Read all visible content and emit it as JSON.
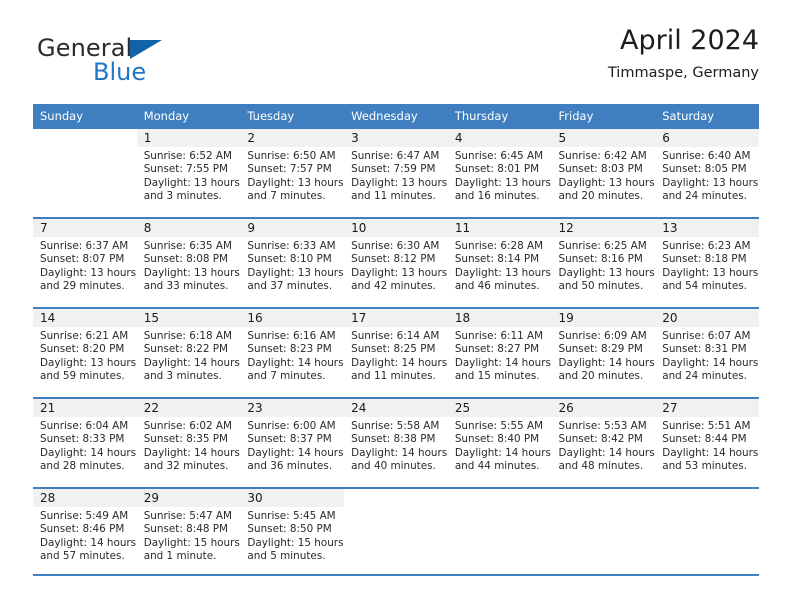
{
  "brand": {
    "name_part1": "General",
    "name_part2": "Blue",
    "flag_icon": "triangle-flag-icon",
    "accent_color": "#1f77c4",
    "header_color": "#3f7fbf"
  },
  "header": {
    "title": "April 2024",
    "subtitle": "Timmaspe, Germany"
  },
  "calendar": {
    "weekday_headers": [
      "Sunday",
      "Monday",
      "Tuesday",
      "Wednesday",
      "Thursday",
      "Friday",
      "Saturday"
    ],
    "weeks": [
      [
        {
          "day": "",
          "sunrise": "",
          "sunset": "",
          "daylight_line1": "",
          "daylight_line2": "",
          "blank": true
        },
        {
          "day": "1",
          "sunrise": "Sunrise: 6:52 AM",
          "sunset": "Sunset: 7:55 PM",
          "daylight_line1": "Daylight: 13 hours",
          "daylight_line2": "and 3 minutes."
        },
        {
          "day": "2",
          "sunrise": "Sunrise: 6:50 AM",
          "sunset": "Sunset: 7:57 PM",
          "daylight_line1": "Daylight: 13 hours",
          "daylight_line2": "and 7 minutes."
        },
        {
          "day": "3",
          "sunrise": "Sunrise: 6:47 AM",
          "sunset": "Sunset: 7:59 PM",
          "daylight_line1": "Daylight: 13 hours",
          "daylight_line2": "and 11 minutes."
        },
        {
          "day": "4",
          "sunrise": "Sunrise: 6:45 AM",
          "sunset": "Sunset: 8:01 PM",
          "daylight_line1": "Daylight: 13 hours",
          "daylight_line2": "and 16 minutes."
        },
        {
          "day": "5",
          "sunrise": "Sunrise: 6:42 AM",
          "sunset": "Sunset: 8:03 PM",
          "daylight_line1": "Daylight: 13 hours",
          "daylight_line2": "and 20 minutes."
        },
        {
          "day": "6",
          "sunrise": "Sunrise: 6:40 AM",
          "sunset": "Sunset: 8:05 PM",
          "daylight_line1": "Daylight: 13 hours",
          "daylight_line2": "and 24 minutes."
        }
      ],
      [
        {
          "day": "7",
          "sunrise": "Sunrise: 6:37 AM",
          "sunset": "Sunset: 8:07 PM",
          "daylight_line1": "Daylight: 13 hours",
          "daylight_line2": "and 29 minutes."
        },
        {
          "day": "8",
          "sunrise": "Sunrise: 6:35 AM",
          "sunset": "Sunset: 8:08 PM",
          "daylight_line1": "Daylight: 13 hours",
          "daylight_line2": "and 33 minutes."
        },
        {
          "day": "9",
          "sunrise": "Sunrise: 6:33 AM",
          "sunset": "Sunset: 8:10 PM",
          "daylight_line1": "Daylight: 13 hours",
          "daylight_line2": "and 37 minutes."
        },
        {
          "day": "10",
          "sunrise": "Sunrise: 6:30 AM",
          "sunset": "Sunset: 8:12 PM",
          "daylight_line1": "Daylight: 13 hours",
          "daylight_line2": "and 42 minutes."
        },
        {
          "day": "11",
          "sunrise": "Sunrise: 6:28 AM",
          "sunset": "Sunset: 8:14 PM",
          "daylight_line1": "Daylight: 13 hours",
          "daylight_line2": "and 46 minutes."
        },
        {
          "day": "12",
          "sunrise": "Sunrise: 6:25 AM",
          "sunset": "Sunset: 8:16 PM",
          "daylight_line1": "Daylight: 13 hours",
          "daylight_line2": "and 50 minutes."
        },
        {
          "day": "13",
          "sunrise": "Sunrise: 6:23 AM",
          "sunset": "Sunset: 8:18 PM",
          "daylight_line1": "Daylight: 13 hours",
          "daylight_line2": "and 54 minutes."
        }
      ],
      [
        {
          "day": "14",
          "sunrise": "Sunrise: 6:21 AM",
          "sunset": "Sunset: 8:20 PM",
          "daylight_line1": "Daylight: 13 hours",
          "daylight_line2": "and 59 minutes."
        },
        {
          "day": "15",
          "sunrise": "Sunrise: 6:18 AM",
          "sunset": "Sunset: 8:22 PM",
          "daylight_line1": "Daylight: 14 hours",
          "daylight_line2": "and 3 minutes."
        },
        {
          "day": "16",
          "sunrise": "Sunrise: 6:16 AM",
          "sunset": "Sunset: 8:23 PM",
          "daylight_line1": "Daylight: 14 hours",
          "daylight_line2": "and 7 minutes."
        },
        {
          "day": "17",
          "sunrise": "Sunrise: 6:14 AM",
          "sunset": "Sunset: 8:25 PM",
          "daylight_line1": "Daylight: 14 hours",
          "daylight_line2": "and 11 minutes."
        },
        {
          "day": "18",
          "sunrise": "Sunrise: 6:11 AM",
          "sunset": "Sunset: 8:27 PM",
          "daylight_line1": "Daylight: 14 hours",
          "daylight_line2": "and 15 minutes."
        },
        {
          "day": "19",
          "sunrise": "Sunrise: 6:09 AM",
          "sunset": "Sunset: 8:29 PM",
          "daylight_line1": "Daylight: 14 hours",
          "daylight_line2": "and 20 minutes."
        },
        {
          "day": "20",
          "sunrise": "Sunrise: 6:07 AM",
          "sunset": "Sunset: 8:31 PM",
          "daylight_line1": "Daylight: 14 hours",
          "daylight_line2": "and 24 minutes."
        }
      ],
      [
        {
          "day": "21",
          "sunrise": "Sunrise: 6:04 AM",
          "sunset": "Sunset: 8:33 PM",
          "daylight_line1": "Daylight: 14 hours",
          "daylight_line2": "and 28 minutes."
        },
        {
          "day": "22",
          "sunrise": "Sunrise: 6:02 AM",
          "sunset": "Sunset: 8:35 PM",
          "daylight_line1": "Daylight: 14 hours",
          "daylight_line2": "and 32 minutes."
        },
        {
          "day": "23",
          "sunrise": "Sunrise: 6:00 AM",
          "sunset": "Sunset: 8:37 PM",
          "daylight_line1": "Daylight: 14 hours",
          "daylight_line2": "and 36 minutes."
        },
        {
          "day": "24",
          "sunrise": "Sunrise: 5:58 AM",
          "sunset": "Sunset: 8:38 PM",
          "daylight_line1": "Daylight: 14 hours",
          "daylight_line2": "and 40 minutes."
        },
        {
          "day": "25",
          "sunrise": "Sunrise: 5:55 AM",
          "sunset": "Sunset: 8:40 PM",
          "daylight_line1": "Daylight: 14 hours",
          "daylight_line2": "and 44 minutes."
        },
        {
          "day": "26",
          "sunrise": "Sunrise: 5:53 AM",
          "sunset": "Sunset: 8:42 PM",
          "daylight_line1": "Daylight: 14 hours",
          "daylight_line2": "and 48 minutes."
        },
        {
          "day": "27",
          "sunrise": "Sunrise: 5:51 AM",
          "sunset": "Sunset: 8:44 PM",
          "daylight_line1": "Daylight: 14 hours",
          "daylight_line2": "and 53 minutes."
        }
      ],
      [
        {
          "day": "28",
          "sunrise": "Sunrise: 5:49 AM",
          "sunset": "Sunset: 8:46 PM",
          "daylight_line1": "Daylight: 14 hours",
          "daylight_line2": "and 57 minutes."
        },
        {
          "day": "29",
          "sunrise": "Sunrise: 5:47 AM",
          "sunset": "Sunset: 8:48 PM",
          "daylight_line1": "Daylight: 15 hours",
          "daylight_line2": "and 1 minute."
        },
        {
          "day": "30",
          "sunrise": "Sunrise: 5:45 AM",
          "sunset": "Sunset: 8:50 PM",
          "daylight_line1": "Daylight: 15 hours",
          "daylight_line2": "and 5 minutes."
        },
        {
          "day": "",
          "sunrise": "",
          "sunset": "",
          "daylight_line1": "",
          "daylight_line2": "",
          "blank": true
        },
        {
          "day": "",
          "sunrise": "",
          "sunset": "",
          "daylight_line1": "",
          "daylight_line2": "",
          "blank": true
        },
        {
          "day": "",
          "sunrise": "",
          "sunset": "",
          "daylight_line1": "",
          "daylight_line2": "",
          "blank": true
        },
        {
          "day": "",
          "sunrise": "",
          "sunset": "",
          "daylight_line1": "",
          "daylight_line2": "",
          "blank": true
        }
      ]
    ]
  }
}
